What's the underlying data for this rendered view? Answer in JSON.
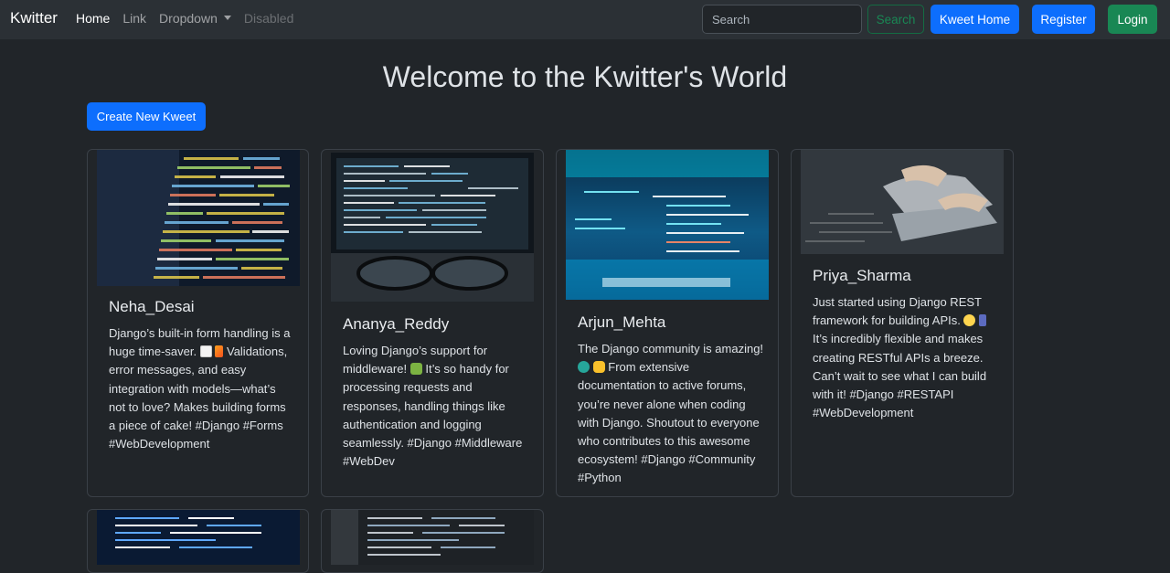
{
  "nav": {
    "brand": "Kwitter",
    "links": {
      "home": "Home",
      "link": "Link",
      "dropdown": "Dropdown",
      "disabled": "Disabled"
    },
    "search_placeholder": "Search",
    "search_button": "Search",
    "kweet_home": "Kweet Home",
    "register": "Register",
    "login": "Login"
  },
  "main": {
    "title": "Welcome to the Kwitter's World",
    "create_button": "Create New Kweet"
  },
  "kweets": [
    {
      "user": "Neha_Desai",
      "text_a": "Django’s built-in form handling is a huge time-saver.",
      "text_b": "Validations, error messages, and easy integration with models—what’s not to love? Makes building forms a piece of cake! #Django #Forms #WebDevelopment"
    },
    {
      "user": "Ananya_Reddy",
      "text_a": "Loving Django’s support for middleware!",
      "text_b": "It’s so handy for processing requests and responses, handling things like authentication and logging seamlessly. #Django #Middleware #WebDev"
    },
    {
      "user": "Arjun_Mehta",
      "text_a": "The Django community is amazing!",
      "text_b": "From extensive documentation to active forums, you’re never alone when coding with Django. Shoutout to everyone who contributes to this awesome ecosystem! #Django #Community #Python"
    },
    {
      "user": "Priya_Sharma",
      "text_a": "Just started using Django REST framework for building APIs.",
      "text_b": "It’s incredibly flexible and makes creating RESTful APIs a breeze. Can’t wait to see what I can build with it! #Django #RESTAPI #WebDevelopment"
    }
  ],
  "colors": {
    "background": "#212529",
    "navbar": "#2b3035",
    "primary": "#0d6efd",
    "success": "#198754"
  },
  "icons": {
    "notepad": "memo-emoji",
    "lightning": "lightning-emoji",
    "puzzle": "puzzle-piece-emoji",
    "globe": "globe-emoji",
    "handshake": "handshake-emoji",
    "sun": "sun-emoji",
    "phone": "mobile-phone-emoji"
  }
}
